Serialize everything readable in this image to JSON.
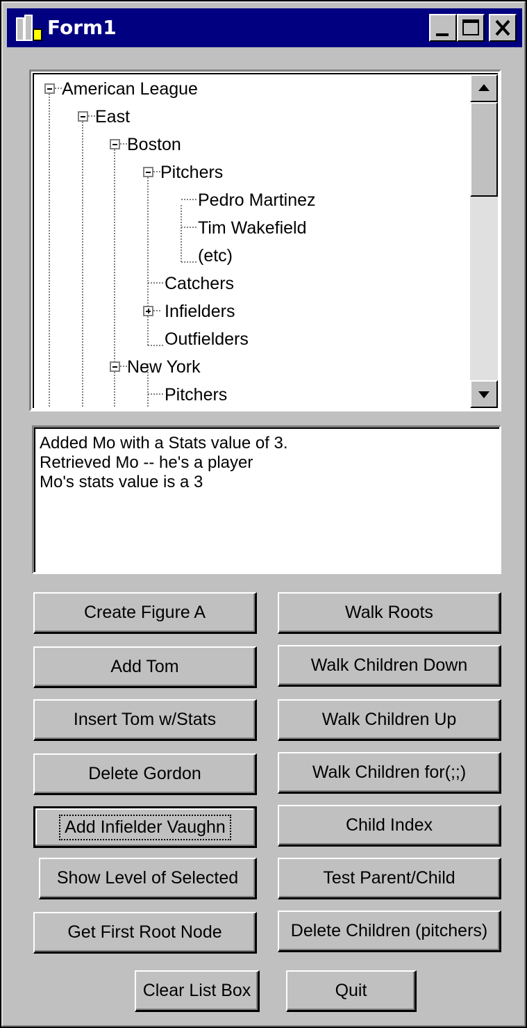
{
  "window": {
    "title": "Form1",
    "title_bar_color": "#000080",
    "face_color": "#c0c0c0",
    "controls": [
      "minimize-icon",
      "maximize-icon",
      "close-icon"
    ]
  },
  "tree": {
    "nodes": [
      {
        "label": "American League",
        "expander": "minus"
      },
      {
        "label": "East",
        "expander": "minus"
      },
      {
        "label": "Boston",
        "expander": "minus"
      },
      {
        "label": "Pitchers",
        "expander": "minus"
      },
      {
        "label": "Pedro Martinez",
        "expander": "none"
      },
      {
        "label": "Tim Wakefield",
        "expander": "none"
      },
      {
        "label": "(etc)",
        "expander": "none"
      },
      {
        "label": "Catchers",
        "expander": "none"
      },
      {
        "label": "Infielders",
        "expander": "plus"
      },
      {
        "label": "Outfielders",
        "expander": "none"
      },
      {
        "label": "New York",
        "expander": "minus"
      },
      {
        "label": "Pitchers",
        "expander": "none"
      }
    ]
  },
  "listbox": {
    "lines": [
      "Added Mo with a Stats value of 3.",
      "Retrieved Mo -- he's a player",
      "Mo's stats value is a 3"
    ]
  },
  "buttons": {
    "create_figure_a": "Create Figure A",
    "walk_roots": "Walk Roots",
    "add_tom": "Add Tom",
    "walk_children_down": "Walk Children Down",
    "insert_tom_stats": "Insert Tom w/Stats",
    "walk_children_up": "Walk Children Up",
    "delete_gordon": "Delete Gordon",
    "walk_children_for": "Walk Children for(;;)",
    "add_infielder_vaughn": "Add Infielder Vaughn",
    "child_index": "Child Index",
    "show_level_selected": "Show Level of Selected",
    "test_parent_child": "Test Parent/Child",
    "get_first_root_node": "Get First Root Node",
    "delete_children_pitchers": "Delete Children (pitchers)",
    "clear_list_box": "Clear List Box",
    "quit": "Quit"
  }
}
